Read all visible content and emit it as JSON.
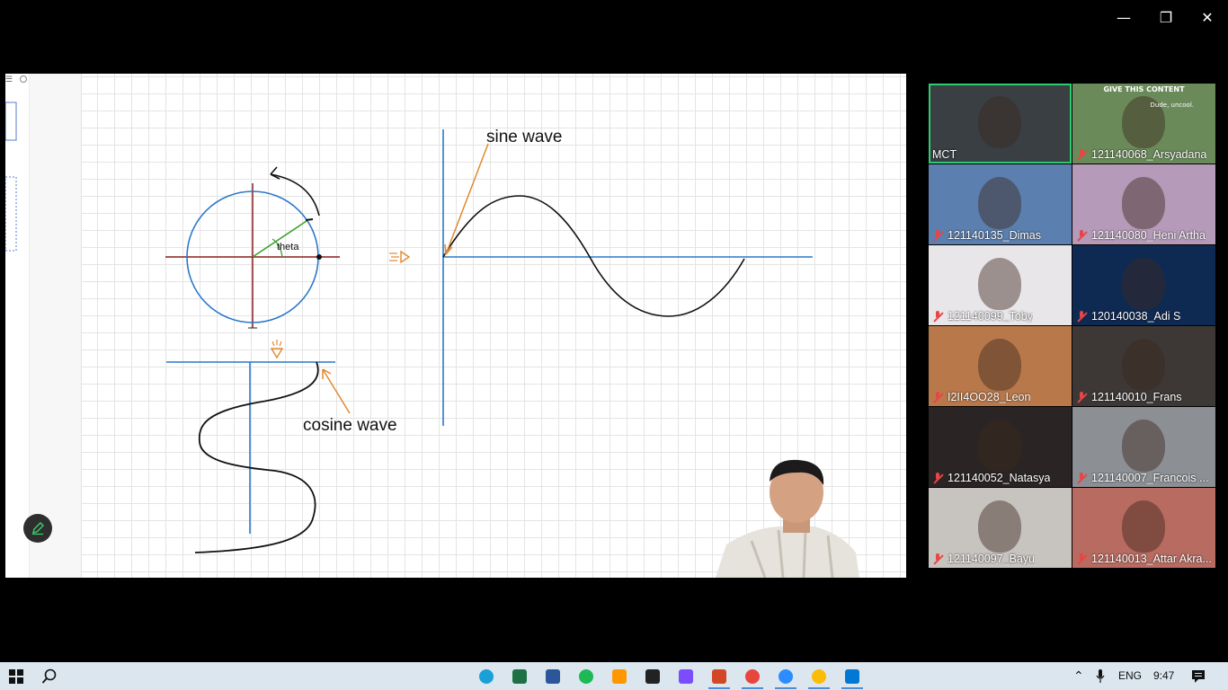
{
  "window": {
    "minimize_glyph": "—",
    "restore_glyph": "❐",
    "close_glyph": "✕"
  },
  "board": {
    "sine_label": "sine wave",
    "cosine_label": "cosine wave",
    "theta_label": "theta"
  },
  "gallery": {
    "participants": [
      {
        "name": "MCT",
        "muted": false,
        "bg": "#3a3f44",
        "active": true
      },
      {
        "name": "121140068_Arsyadana",
        "muted": true,
        "bg": "#6b8a5a",
        "banner": "GIVE THIS CONTENT",
        "caption": "Dude, uncool."
      },
      {
        "name": "121140135_Dimas",
        "muted": true,
        "bg": "#5b7fae"
      },
      {
        "name": "121140080_Heni Artha",
        "muted": true,
        "bg": "#b59ab9"
      },
      {
        "name": "121140099_Toby",
        "muted": true,
        "bg": "#e9e6ea"
      },
      {
        "name": "120140038_Adi S",
        "muted": true,
        "bg": "#0f2a52"
      },
      {
        "name": "I2II4OO28_Leon",
        "muted": true,
        "bg": "#b9784a"
      },
      {
        "name": "121140010_Frans",
        "muted": true,
        "bg": "#3d3836"
      },
      {
        "name": "121140052_Natasya",
        "muted": true,
        "bg": "#2a2524"
      },
      {
        "name": "121140007_Francois ...",
        "muted": true,
        "bg": "#8c8f94"
      },
      {
        "name": "121140097_Bayu",
        "muted": true,
        "bg": "#c7c3bf"
      },
      {
        "name": "121140013_Attar Akra...",
        "muted": true,
        "bg": "#b86b60"
      }
    ]
  },
  "taskbar": {
    "apps": [
      "edge-icon",
      "excel-icon",
      "word-icon",
      "spotify-icon",
      "sublime-icon",
      "notion-icon",
      "obsidian-icon",
      "powerpoint-icon",
      "chrome-icon",
      "zoom-icon",
      "chrome-icon-2",
      "vscode-icon"
    ],
    "language": "ENG",
    "time": "9:47"
  }
}
